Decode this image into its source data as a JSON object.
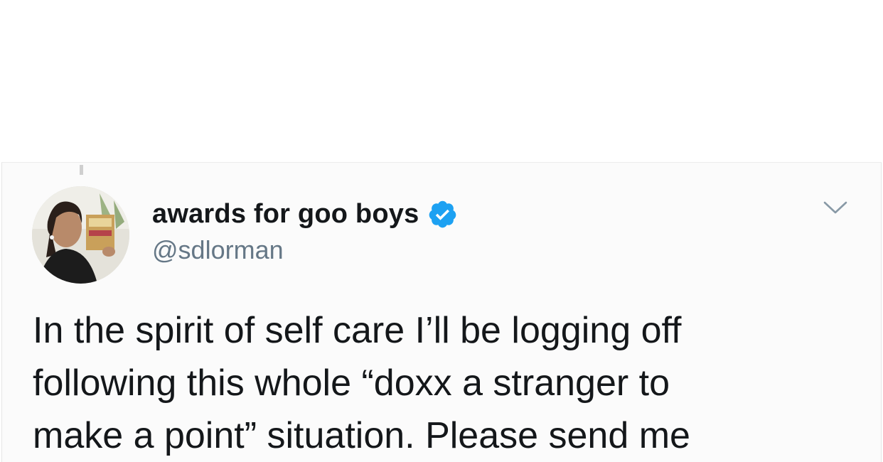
{
  "tweet": {
    "display_name": "awards for goo boys",
    "handle": "@sdlorman",
    "body_lines": [
      "In the spirit of self care I’ll be logging off",
      "following this whole “doxx a stranger to",
      "make a point” situation. Please send me"
    ]
  },
  "icons": {
    "verified": "verified-badge-icon",
    "caret": "chevron-down-icon"
  },
  "colors": {
    "verified_blue": "#1da1f2",
    "text": "#14171a",
    "handle_gray": "#657786",
    "card_bg": "#fbfbfb"
  }
}
